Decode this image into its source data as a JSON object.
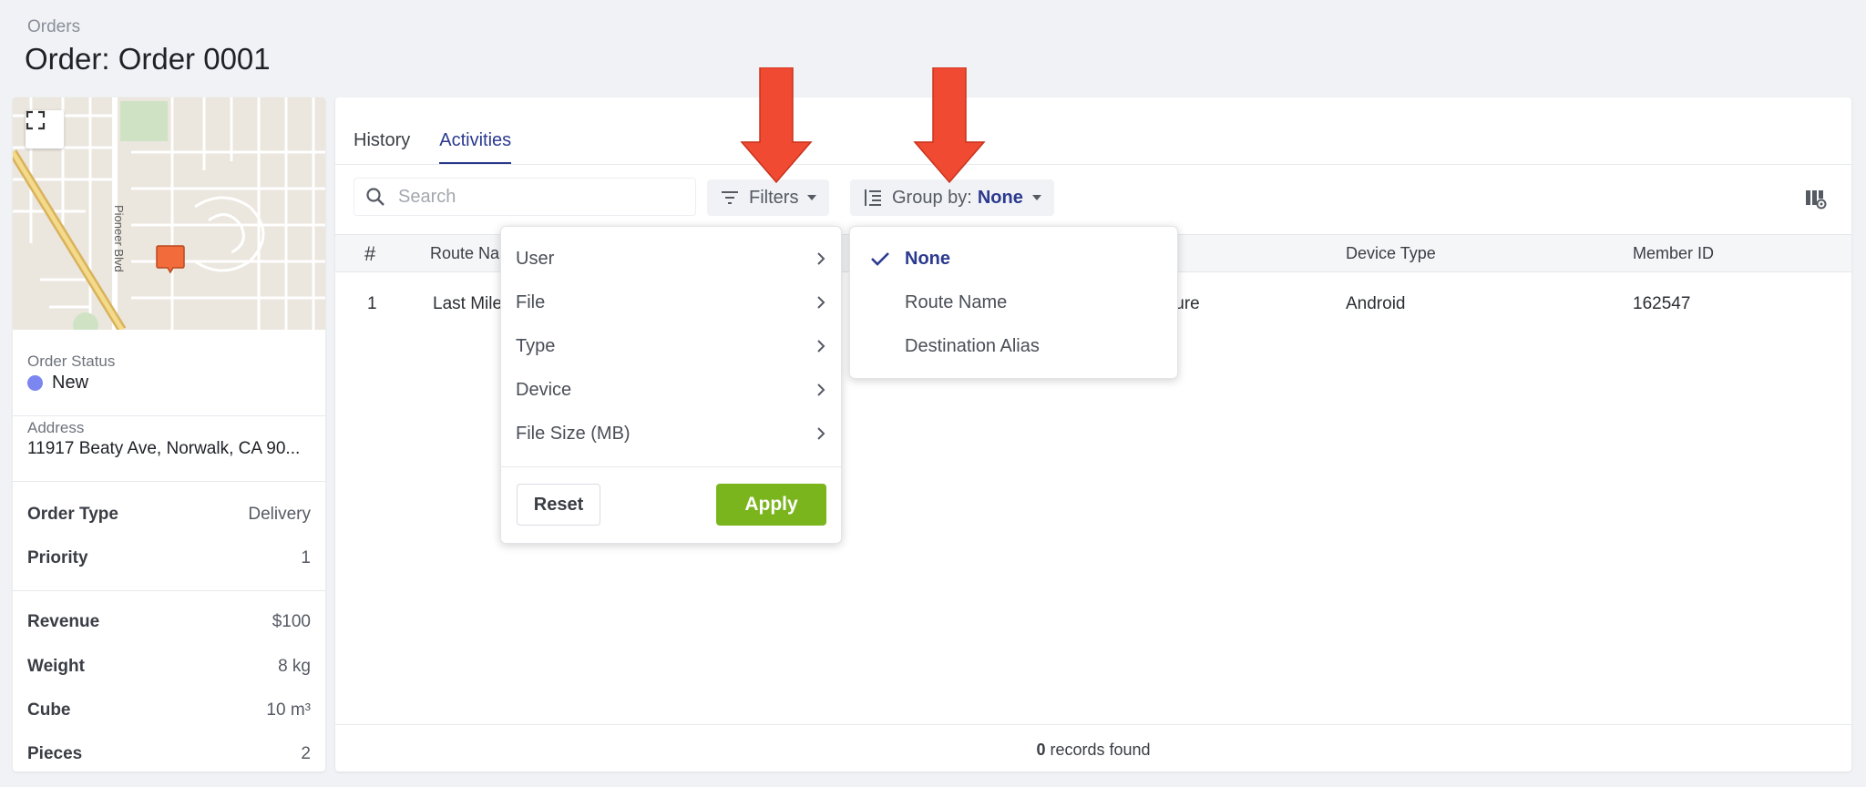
{
  "breadcrumb": "Orders",
  "page_title": "Order: Order 0001",
  "map": {
    "street_label": "Pioneer Blvd"
  },
  "order": {
    "status_label": "Order Status",
    "status_value": "New",
    "status_color": "#7b86f0",
    "address_label": "Address",
    "address_value": "11917 Beaty Ave, Norwalk, CA 90...",
    "details": [
      {
        "key": "Order Type",
        "value": "Delivery"
      },
      {
        "key": "Priority",
        "value": "1"
      }
    ],
    "metrics": [
      {
        "key": "Revenue",
        "value": "$100"
      },
      {
        "key": "Weight",
        "value": "8 kg"
      },
      {
        "key": "Cube",
        "value": "10 m³"
      },
      {
        "key": "Pieces",
        "value": "2"
      }
    ]
  },
  "tabs": [
    {
      "label": "History",
      "active": false
    },
    {
      "label": "Activities",
      "active": true
    }
  ],
  "toolbar": {
    "search_placeholder": "Search",
    "filters_label": "Filters",
    "group_by_label": "Group by:",
    "group_by_value": "None"
  },
  "table": {
    "headers": [
      "#",
      "Route Na",
      "Device Type",
      "Member ID"
    ],
    "rows": [
      {
        "num": "1",
        "route": "Last Mile",
        "hidden_col": "ture",
        "device": "Android",
        "member": "162547"
      }
    ]
  },
  "footer": {
    "count": "0",
    "suffix": "records found"
  },
  "filters_menu": {
    "items": [
      "User",
      "File",
      "Type",
      "Device",
      "File Size (MB)"
    ],
    "reset_label": "Reset",
    "apply_label": "Apply"
  },
  "group_menu": {
    "items": [
      "None",
      "Route Name",
      "Destination Alias"
    ],
    "selected": "None"
  },
  "colors": {
    "accent": "#2b3a8f",
    "apply": "#7ab51d",
    "annotation_arrow": "#f04a32"
  }
}
